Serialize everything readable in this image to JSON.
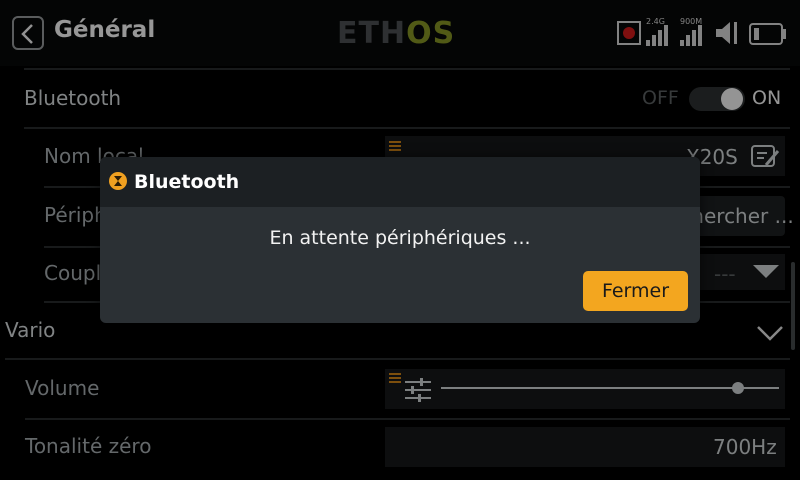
{
  "header": {
    "title": "Général",
    "logo_part1": "ETH",
    "logo_part2": "OS",
    "status": {
      "rf_band": "2.4G",
      "rf_band2": "900M"
    }
  },
  "bluetooth_row": {
    "label": "Bluetooth",
    "off": "OFF",
    "on": "ON"
  },
  "local_name_row": {
    "label": "Nom local",
    "value": "X20S"
  },
  "peripheral_row": {
    "label": "Périphérique",
    "value": "Rechercher ..."
  },
  "coupling_row": {
    "label": "Couplage",
    "value": "---"
  },
  "vario_section": {
    "label": "Vario"
  },
  "volume_row": {
    "label": "Volume",
    "level": 0.88
  },
  "zero_tone_row": {
    "label": "Tonalité zéro",
    "value": "700Hz"
  },
  "dialog": {
    "title": "Bluetooth",
    "message": "En attente périphériques ...",
    "close_label": "Fermer"
  },
  "colors": {
    "accent": "#f3a61f",
    "logo_green": "#7d8a22"
  }
}
